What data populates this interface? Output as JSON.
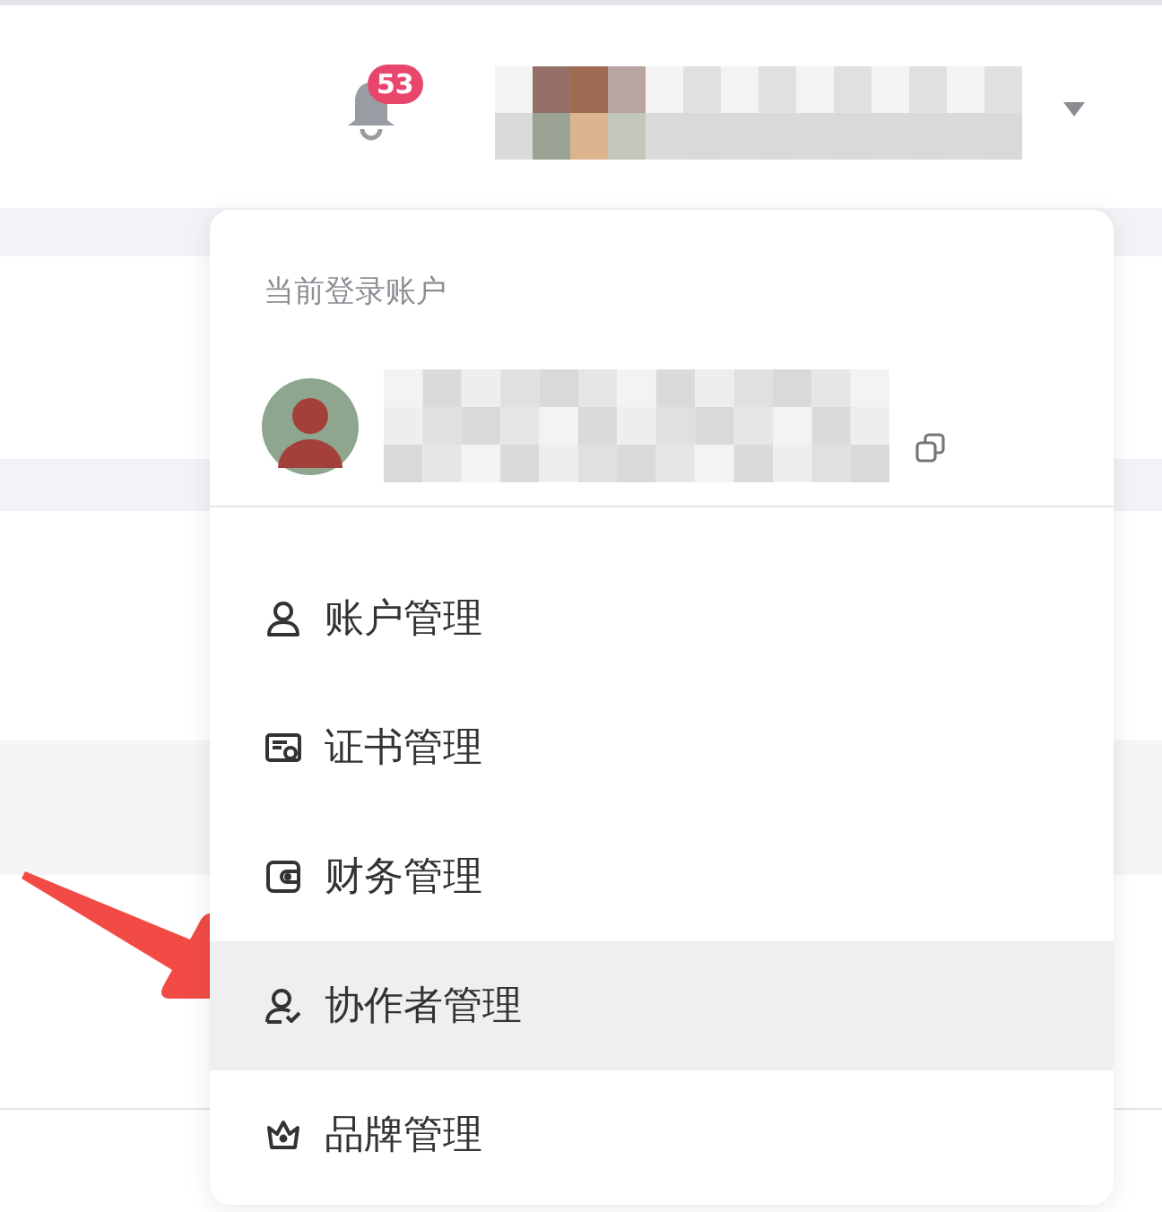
{
  "header": {
    "notifications": {
      "badge": "53"
    }
  },
  "account_menu": {
    "section_label": "当前登录账户",
    "items": [
      {
        "kind": "person",
        "label": "账户管理",
        "selected": false
      },
      {
        "kind": "certificate",
        "label": "证书管理",
        "selected": false
      },
      {
        "kind": "wallet",
        "label": "财务管理",
        "selected": false
      },
      {
        "kind": "collaborator",
        "label": "协作者管理",
        "selected": true
      },
      {
        "kind": "crown",
        "label": "品牌管理",
        "selected": false
      }
    ]
  }
}
